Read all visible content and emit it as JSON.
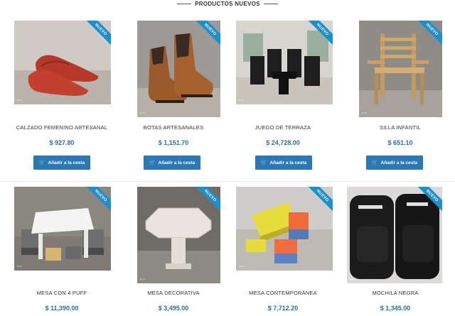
{
  "section": {
    "title": "PRODUCTOS NUEVOS"
  },
  "badge": "NUEVO",
  "add_label": "Añadir a la cesta",
  "products": [
    {
      "name": "CALZADO FEMENINO ARTESANAL",
      "price": "$ 927.80"
    },
    {
      "name": "BOTAS ARTESANALES",
      "price": "$ 1,151.70"
    },
    {
      "name": "JUEGO DE TERRAZA",
      "price": "$ 24,728.00"
    },
    {
      "name": "SILLA INFANTIL",
      "price": "$ 651.10"
    },
    {
      "name": "MESA CON 4 PUFF",
      "price": "$ 11,390.00"
    },
    {
      "name": "MESA DECORATIVA",
      "price": "$ 3,495.00"
    },
    {
      "name": "MESA CONTEMPORÁNEA",
      "price": "$ 7,712.20"
    },
    {
      "name": "MOCHILA NEGRA",
      "price": "$ 1,345.00"
    }
  ],
  "colors": {
    "accent": "#2a78b5",
    "badge": "#1c8fd0",
    "price": "#2b6fa8"
  }
}
